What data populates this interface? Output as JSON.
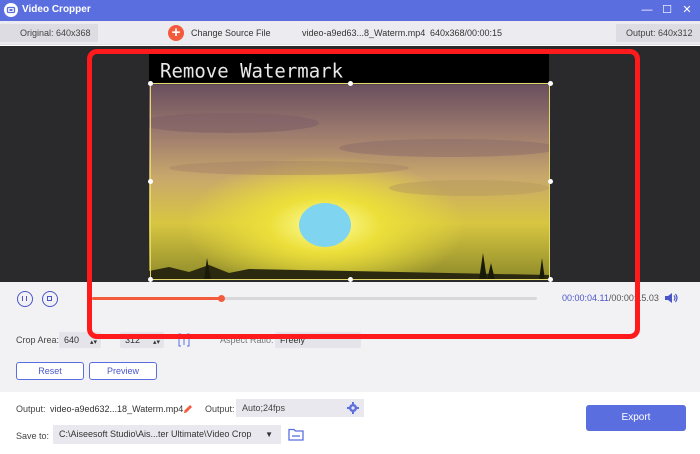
{
  "window": {
    "title": "Video Cropper",
    "controls": {
      "minimize": "—",
      "maximize": "☐",
      "close": "✕"
    }
  },
  "infobar": {
    "original": "Original: 640x368",
    "change_source": "Change Source File",
    "file_name": "video-a9ed63...8_Waterm.mp4",
    "file_info": "640x368/00:00:15",
    "output": "Output: 640x312"
  },
  "preview": {
    "watermark_text": "Remove Watermark"
  },
  "playback": {
    "progress": 0.29,
    "current_time": "00:00:04.11",
    "total_time": "/00:00:15.03"
  },
  "crop": {
    "label": "Crop Area:",
    "width": "640",
    "height": "312",
    "aspect_label": "Aspect Ratio:",
    "aspect_value": "Freely"
  },
  "buttons": {
    "reset": "Reset",
    "preview": "Preview",
    "export": "Export"
  },
  "output": {
    "label": "Output:",
    "file": "video-a9ed632...18_Waterm.mp4",
    "format_label": "Output:",
    "format_value": "Auto;24fps"
  },
  "save": {
    "label": "Save to:",
    "path": "C:\\Aiseesoft Studio\\Ais...ter Ultimate\\Video Crop"
  },
  "colors": {
    "accent": "#5b6ee0",
    "orange": "#f35b3c",
    "highlight": "#ff1b1b"
  }
}
